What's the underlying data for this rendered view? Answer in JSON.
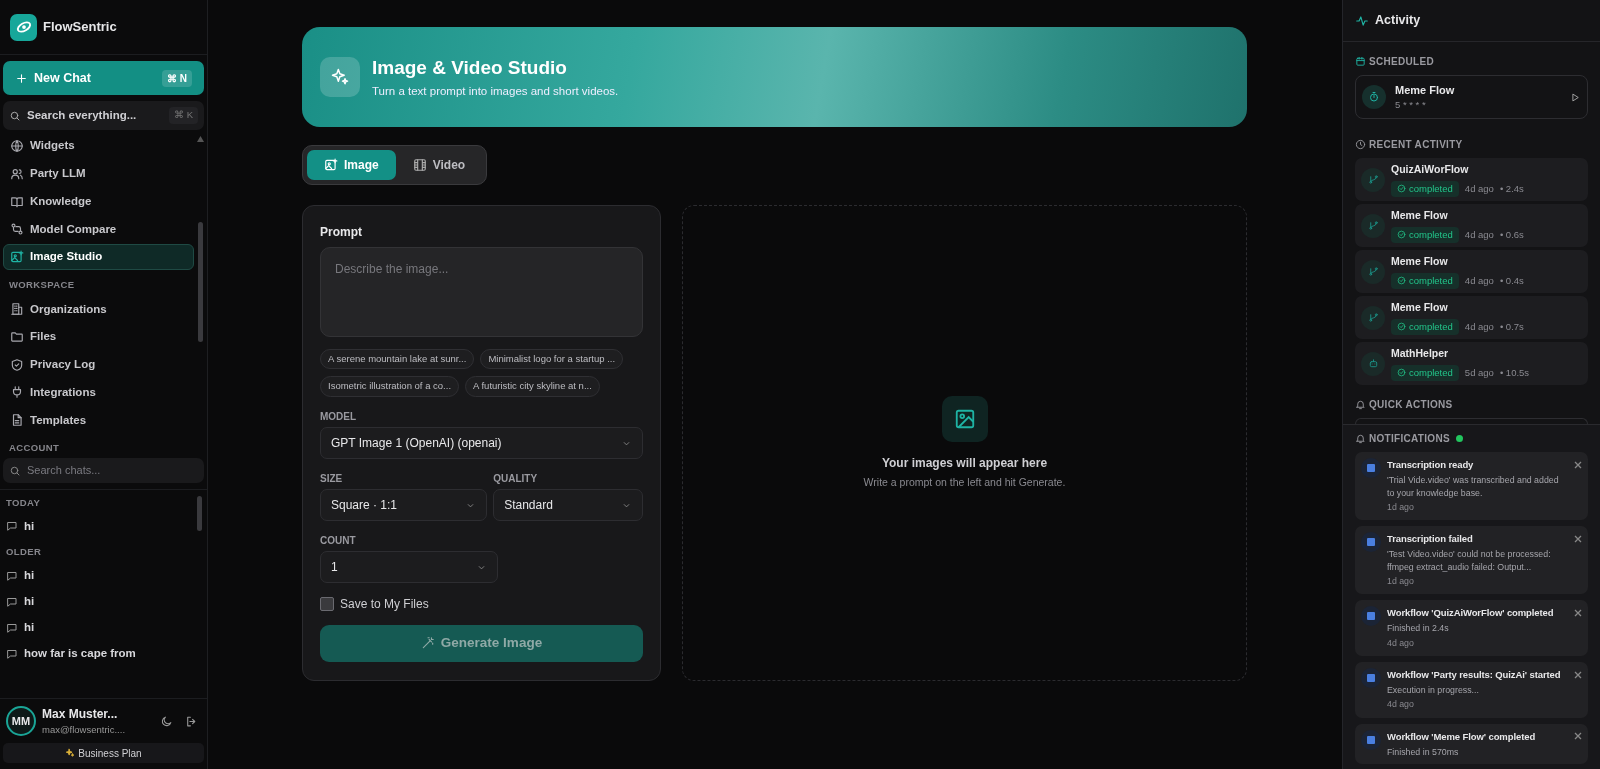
{
  "brand": {
    "name": "FlowSentric"
  },
  "new_chat": {
    "label": "New Chat",
    "shortcut": "⌘ N"
  },
  "search": {
    "placeholder": "Search everything...",
    "shortcut": "⌘ K"
  },
  "nav": [
    {
      "label": "Widgets",
      "selected": false
    },
    {
      "label": "Party LLM",
      "selected": false
    },
    {
      "label": "Knowledge",
      "selected": false
    },
    {
      "label": "Model Compare",
      "selected": false
    },
    {
      "label": "Image Studio",
      "selected": true
    }
  ],
  "workspace": {
    "heading": "WORKSPACE",
    "items": [
      {
        "label": "Organizations",
        "selected": false
      },
      {
        "label": "Files",
        "selected": false
      },
      {
        "label": "Privacy Log",
        "selected": false
      },
      {
        "label": "Integrations",
        "selected": false
      },
      {
        "label": "Templates",
        "selected": false
      }
    ]
  },
  "account": {
    "heading": "ACCOUNT"
  },
  "chat_search": {
    "placeholder": "Search chats..."
  },
  "chat_groups": [
    {
      "heading": "TODAY",
      "chats": [
        "hi"
      ]
    },
    {
      "heading": "OLDER",
      "chats": [
        "hi",
        "hi",
        "hi",
        "how far is cape from"
      ]
    }
  ],
  "user": {
    "initials": "MM",
    "name": "Max Muster...",
    "email": "max@flowsentric....",
    "plan": "Business Plan"
  },
  "studio": {
    "title": "Image & Video Studio",
    "subtitle": "Turn a text prompt into images and short videos."
  },
  "modes": [
    {
      "label": "Image",
      "selected": true
    },
    {
      "label": "Video",
      "selected": false
    }
  ],
  "form": {
    "prompt_label": "Prompt",
    "prompt_placeholder": "Describe the image...",
    "suggestions": [
      "A serene mountain lake at sunr...",
      "Minimalist logo for a startup ...",
      "Isometric illustration of a co...",
      "A futuristic city skyline at n..."
    ],
    "model": {
      "label": "MODEL",
      "value": "GPT Image 1 (OpenAI) (openai)"
    },
    "size": {
      "label": "SIZE",
      "value": "Square · 1:1"
    },
    "quality": {
      "label": "QUALITY",
      "value": "Standard"
    },
    "count": {
      "label": "COUNT",
      "value": "1"
    },
    "save": {
      "label": "Save to My Files",
      "checked": false
    },
    "generate": {
      "label": "Generate Image",
      "disabled": true
    }
  },
  "preview": {
    "title": "Your images will appear here",
    "hint": "Write a prompt on the left and hit Generate."
  },
  "activity": {
    "title": "Activity",
    "scheduled_heading": "SCHEDULED",
    "scheduled": [
      {
        "name": "Meme Flow",
        "cron": "5 * * * *"
      }
    ],
    "recent_heading": "RECENT ACTIVITY",
    "recent": [
      {
        "name": "QuizAiWorFlow",
        "kind": "workflow",
        "status": "completed",
        "age": "4d ago",
        "duration": "• 2.4s"
      },
      {
        "name": "Meme Flow",
        "kind": "workflow",
        "status": "completed",
        "age": "4d ago",
        "duration": "• 0.6s"
      },
      {
        "name": "Meme Flow",
        "kind": "workflow",
        "status": "completed",
        "age": "4d ago",
        "duration": "• 0.4s"
      },
      {
        "name": "Meme Flow",
        "kind": "workflow",
        "status": "completed",
        "age": "4d ago",
        "duration": "• 0.7s"
      },
      {
        "name": "MathHelper",
        "kind": "agent",
        "status": "completed",
        "age": "5d ago",
        "duration": "• 10.5s"
      }
    ],
    "quick_heading": "QUICK ACTIONS"
  },
  "notifications": {
    "heading": "NOTIFICATIONS",
    "unread": true,
    "items": [
      {
        "title": "Transcription ready",
        "body": "'Trial Vide.video' was transcribed and added to your knowledge base.",
        "age": "1d ago"
      },
      {
        "title": "Transcription failed",
        "body": "'Test Video.video' could not be processed: ffmpeg extract_audio failed: Output...",
        "age": "1d ago"
      },
      {
        "title": "Workflow 'QuizAiWorFlow' completed",
        "body": "Finished in 2.4s",
        "age": "4d ago"
      },
      {
        "title": "Workflow 'Party results: QuizAi' started",
        "body": "Execution in progress...",
        "age": "4d ago"
      },
      {
        "title": "Workflow 'Meme Flow' completed",
        "body": "Finished in 570ms"
      }
    ]
  }
}
